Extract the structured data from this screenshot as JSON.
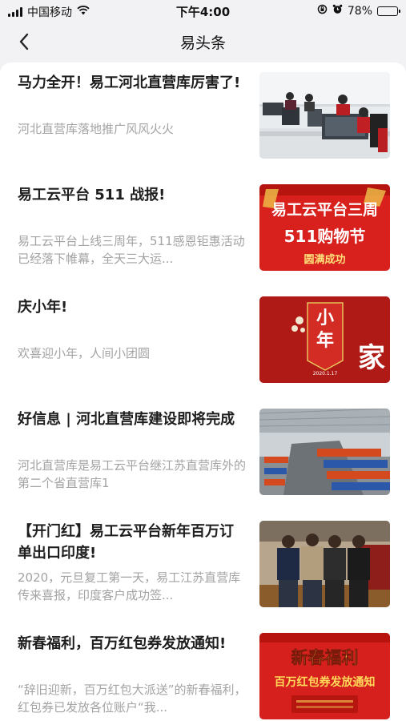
{
  "status_bar": {
    "carrier": "中国移动",
    "time": "下午4:00",
    "battery": "78%",
    "battery_level": 0.78,
    "icons": [
      "signal-icon",
      "wifi-icon",
      "rotation-lock-icon",
      "alarm-icon",
      "battery-icon"
    ]
  },
  "nav": {
    "back_icon": "chevron-left-icon",
    "title": "易头条"
  },
  "articles": [
    {
      "title": "马力全开！易工河北直营库厉害了!",
      "summary": "河北直营库落地推广风风火火"
    },
    {
      "title": "易工云平台 511 战报!",
      "summary": "易工云平台上线三周年，511感恩钜惠活动已经落下帷幕，全天三大运...",
      "thumb_text": [
        "易工云平台三周",
        "511购物节",
        "圆满成功"
      ]
    },
    {
      "title": "庆小年!",
      "summary": "欢喜迎小年，人间小团圆",
      "thumb_text": [
        "小",
        "年",
        "家",
        "2020.1.17"
      ]
    },
    {
      "title": "好信息 | 河北直营库建设即将完成",
      "summary": "河北直营库是易工云平台继江苏直营库外的第二个省直营库1"
    },
    {
      "title": "【开门红】易工云平台新年百万订单出口印度!",
      "summary": "2020，元旦复工第一天，易工江苏直营库传来喜报，印度客户成功签..."
    },
    {
      "title": "新春福利，百万红包券发放通知!",
      "summary": "“辞旧迎新，百万红包大派送”的新春福利，红包券已发放各位账户“我...",
      "thumb_text": [
        "新春福利",
        "百万红包券发放通知"
      ]
    }
  ],
  "colors": {
    "accent_red": "#d9221e",
    "summary_gray": "#a3a3a3",
    "title_black": "#1e1e1e"
  }
}
